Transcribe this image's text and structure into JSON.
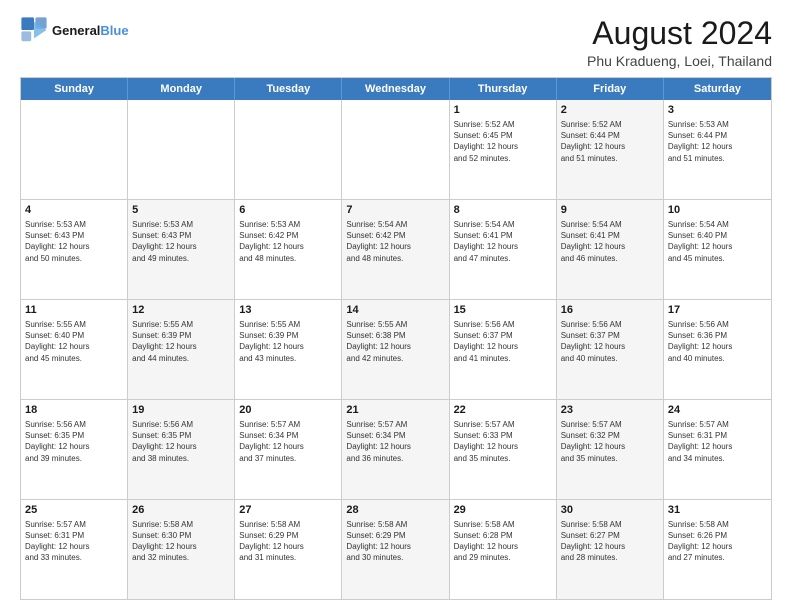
{
  "logo": {
    "line1": "General",
    "line2": "Blue",
    "icon": "🔵"
  },
  "title": "August 2024",
  "subtitle": "Phu Kradueng, Loei, Thailand",
  "header_days": [
    "Sunday",
    "Monday",
    "Tuesday",
    "Wednesday",
    "Thursday",
    "Friday",
    "Saturday"
  ],
  "rows": [
    [
      {
        "day": "",
        "info": "",
        "shaded": false
      },
      {
        "day": "",
        "info": "",
        "shaded": false
      },
      {
        "day": "",
        "info": "",
        "shaded": false
      },
      {
        "day": "",
        "info": "",
        "shaded": false
      },
      {
        "day": "1",
        "info": "Sunrise: 5:52 AM\nSunset: 6:45 PM\nDaylight: 12 hours\nand 52 minutes.",
        "shaded": false
      },
      {
        "day": "2",
        "info": "Sunrise: 5:52 AM\nSunset: 6:44 PM\nDaylight: 12 hours\nand 51 minutes.",
        "shaded": true
      },
      {
        "day": "3",
        "info": "Sunrise: 5:53 AM\nSunset: 6:44 PM\nDaylight: 12 hours\nand 51 minutes.",
        "shaded": false
      }
    ],
    [
      {
        "day": "4",
        "info": "Sunrise: 5:53 AM\nSunset: 6:43 PM\nDaylight: 12 hours\nand 50 minutes.",
        "shaded": false
      },
      {
        "day": "5",
        "info": "Sunrise: 5:53 AM\nSunset: 6:43 PM\nDaylight: 12 hours\nand 49 minutes.",
        "shaded": true
      },
      {
        "day": "6",
        "info": "Sunrise: 5:53 AM\nSunset: 6:42 PM\nDaylight: 12 hours\nand 48 minutes.",
        "shaded": false
      },
      {
        "day": "7",
        "info": "Sunrise: 5:54 AM\nSunset: 6:42 PM\nDaylight: 12 hours\nand 48 minutes.",
        "shaded": true
      },
      {
        "day": "8",
        "info": "Sunrise: 5:54 AM\nSunset: 6:41 PM\nDaylight: 12 hours\nand 47 minutes.",
        "shaded": false
      },
      {
        "day": "9",
        "info": "Sunrise: 5:54 AM\nSunset: 6:41 PM\nDaylight: 12 hours\nand 46 minutes.",
        "shaded": true
      },
      {
        "day": "10",
        "info": "Sunrise: 5:54 AM\nSunset: 6:40 PM\nDaylight: 12 hours\nand 45 minutes.",
        "shaded": false
      }
    ],
    [
      {
        "day": "11",
        "info": "Sunrise: 5:55 AM\nSunset: 6:40 PM\nDaylight: 12 hours\nand 45 minutes.",
        "shaded": false
      },
      {
        "day": "12",
        "info": "Sunrise: 5:55 AM\nSunset: 6:39 PM\nDaylight: 12 hours\nand 44 minutes.",
        "shaded": true
      },
      {
        "day": "13",
        "info": "Sunrise: 5:55 AM\nSunset: 6:39 PM\nDaylight: 12 hours\nand 43 minutes.",
        "shaded": false
      },
      {
        "day": "14",
        "info": "Sunrise: 5:55 AM\nSunset: 6:38 PM\nDaylight: 12 hours\nand 42 minutes.",
        "shaded": true
      },
      {
        "day": "15",
        "info": "Sunrise: 5:56 AM\nSunset: 6:37 PM\nDaylight: 12 hours\nand 41 minutes.",
        "shaded": false
      },
      {
        "day": "16",
        "info": "Sunrise: 5:56 AM\nSunset: 6:37 PM\nDaylight: 12 hours\nand 40 minutes.",
        "shaded": true
      },
      {
        "day": "17",
        "info": "Sunrise: 5:56 AM\nSunset: 6:36 PM\nDaylight: 12 hours\nand 40 minutes.",
        "shaded": false
      }
    ],
    [
      {
        "day": "18",
        "info": "Sunrise: 5:56 AM\nSunset: 6:35 PM\nDaylight: 12 hours\nand 39 minutes.",
        "shaded": false
      },
      {
        "day": "19",
        "info": "Sunrise: 5:56 AM\nSunset: 6:35 PM\nDaylight: 12 hours\nand 38 minutes.",
        "shaded": true
      },
      {
        "day": "20",
        "info": "Sunrise: 5:57 AM\nSunset: 6:34 PM\nDaylight: 12 hours\nand 37 minutes.",
        "shaded": false
      },
      {
        "day": "21",
        "info": "Sunrise: 5:57 AM\nSunset: 6:34 PM\nDaylight: 12 hours\nand 36 minutes.",
        "shaded": true
      },
      {
        "day": "22",
        "info": "Sunrise: 5:57 AM\nSunset: 6:33 PM\nDaylight: 12 hours\nand 35 minutes.",
        "shaded": false
      },
      {
        "day": "23",
        "info": "Sunrise: 5:57 AM\nSunset: 6:32 PM\nDaylight: 12 hours\nand 35 minutes.",
        "shaded": true
      },
      {
        "day": "24",
        "info": "Sunrise: 5:57 AM\nSunset: 6:31 PM\nDaylight: 12 hours\nand 34 minutes.",
        "shaded": false
      }
    ],
    [
      {
        "day": "25",
        "info": "Sunrise: 5:57 AM\nSunset: 6:31 PM\nDaylight: 12 hours\nand 33 minutes.",
        "shaded": false
      },
      {
        "day": "26",
        "info": "Sunrise: 5:58 AM\nSunset: 6:30 PM\nDaylight: 12 hours\nand 32 minutes.",
        "shaded": true
      },
      {
        "day": "27",
        "info": "Sunrise: 5:58 AM\nSunset: 6:29 PM\nDaylight: 12 hours\nand 31 minutes.",
        "shaded": false
      },
      {
        "day": "28",
        "info": "Sunrise: 5:58 AM\nSunset: 6:29 PM\nDaylight: 12 hours\nand 30 minutes.",
        "shaded": true
      },
      {
        "day": "29",
        "info": "Sunrise: 5:58 AM\nSunset: 6:28 PM\nDaylight: 12 hours\nand 29 minutes.",
        "shaded": false
      },
      {
        "day": "30",
        "info": "Sunrise: 5:58 AM\nSunset: 6:27 PM\nDaylight: 12 hours\nand 28 minutes.",
        "shaded": true
      },
      {
        "day": "31",
        "info": "Sunrise: 5:58 AM\nSunset: 6:26 PM\nDaylight: 12 hours\nand 27 minutes.",
        "shaded": false
      }
    ]
  ]
}
